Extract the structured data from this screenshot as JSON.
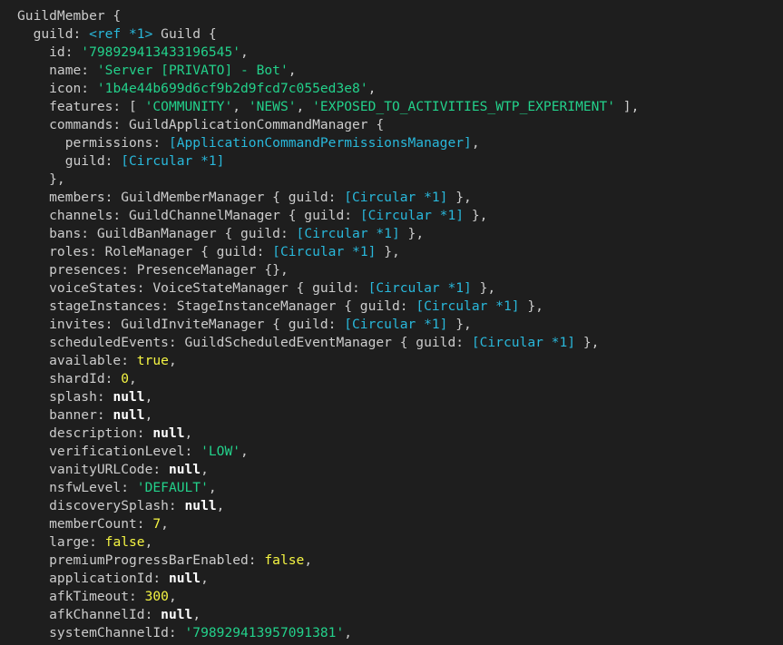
{
  "colors": {
    "background": "#1e1e1e",
    "text": "#cccccc",
    "string": "#23d18b",
    "number": "#f5f543",
    "boolean": "#f5f543",
    "null": "#ffffff",
    "reference": "#29b8db"
  },
  "lines": [
    [
      [
        "plain",
        "GuildMember {"
      ]
    ],
    [
      [
        "plain",
        "  guild: "
      ],
      [
        "ref",
        "<ref *1>"
      ],
      [
        "plain",
        " Guild {"
      ]
    ],
    [
      [
        "plain",
        "    id: "
      ],
      [
        "str",
        "'798929413433196545'"
      ],
      [
        "plain",
        ","
      ]
    ],
    [
      [
        "plain",
        "    name: "
      ],
      [
        "str",
        "'Server [PRIVATO] - Bot'"
      ],
      [
        "plain",
        ","
      ]
    ],
    [
      [
        "plain",
        "    icon: "
      ],
      [
        "str",
        "'1b4e44b699d6cf9b2d9fcd7c055ed3e8'"
      ],
      [
        "plain",
        ","
      ]
    ],
    [
      [
        "plain",
        "    features: [ "
      ],
      [
        "str",
        "'COMMUNITY'"
      ],
      [
        "plain",
        ", "
      ],
      [
        "str",
        "'NEWS'"
      ],
      [
        "plain",
        ", "
      ],
      [
        "str",
        "'EXPOSED_TO_ACTIVITIES_WTP_EXPERIMENT'"
      ],
      [
        "plain",
        " ],"
      ]
    ],
    [
      [
        "plain",
        "    commands: GuildApplicationCommandManager {"
      ]
    ],
    [
      [
        "plain",
        "      permissions: "
      ],
      [
        "ref",
        "[ApplicationCommandPermissionsManager]"
      ],
      [
        "plain",
        ","
      ]
    ],
    [
      [
        "plain",
        "      guild: "
      ],
      [
        "ref",
        "[Circular *1]"
      ]
    ],
    [
      [
        "plain",
        "    },"
      ]
    ],
    [
      [
        "plain",
        "    members: GuildMemberManager { guild: "
      ],
      [
        "ref",
        "[Circular *1]"
      ],
      [
        "plain",
        " },"
      ]
    ],
    [
      [
        "plain",
        "    channels: GuildChannelManager { guild: "
      ],
      [
        "ref",
        "[Circular *1]"
      ],
      [
        "plain",
        " },"
      ]
    ],
    [
      [
        "plain",
        "    bans: GuildBanManager { guild: "
      ],
      [
        "ref",
        "[Circular *1]"
      ],
      [
        "plain",
        " },"
      ]
    ],
    [
      [
        "plain",
        "    roles: RoleManager { guild: "
      ],
      [
        "ref",
        "[Circular *1]"
      ],
      [
        "plain",
        " },"
      ]
    ],
    [
      [
        "plain",
        "    presences: PresenceManager {},"
      ]
    ],
    [
      [
        "plain",
        "    voiceStates: VoiceStateManager { guild: "
      ],
      [
        "ref",
        "[Circular *1]"
      ],
      [
        "plain",
        " },"
      ]
    ],
    [
      [
        "plain",
        "    stageInstances: StageInstanceManager { guild: "
      ],
      [
        "ref",
        "[Circular *1]"
      ],
      [
        "plain",
        " },"
      ]
    ],
    [
      [
        "plain",
        "    invites: GuildInviteManager { guild: "
      ],
      [
        "ref",
        "[Circular *1]"
      ],
      [
        "plain",
        " },"
      ]
    ],
    [
      [
        "plain",
        "    scheduledEvents: GuildScheduledEventManager { guild: "
      ],
      [
        "ref",
        "[Circular *1]"
      ],
      [
        "plain",
        " },"
      ]
    ],
    [
      [
        "plain",
        "    available: "
      ],
      [
        "bool",
        "true"
      ],
      [
        "plain",
        ","
      ]
    ],
    [
      [
        "plain",
        "    shardId: "
      ],
      [
        "num",
        "0"
      ],
      [
        "plain",
        ","
      ]
    ],
    [
      [
        "plain",
        "    splash: "
      ],
      [
        "null",
        "null"
      ],
      [
        "plain",
        ","
      ]
    ],
    [
      [
        "plain",
        "    banner: "
      ],
      [
        "null",
        "null"
      ],
      [
        "plain",
        ","
      ]
    ],
    [
      [
        "plain",
        "    description: "
      ],
      [
        "null",
        "null"
      ],
      [
        "plain",
        ","
      ]
    ],
    [
      [
        "plain",
        "    verificationLevel: "
      ],
      [
        "str",
        "'LOW'"
      ],
      [
        "plain",
        ","
      ]
    ],
    [
      [
        "plain",
        "    vanityURLCode: "
      ],
      [
        "null",
        "null"
      ],
      [
        "plain",
        ","
      ]
    ],
    [
      [
        "plain",
        "    nsfwLevel: "
      ],
      [
        "str",
        "'DEFAULT'"
      ],
      [
        "plain",
        ","
      ]
    ],
    [
      [
        "plain",
        "    discoverySplash: "
      ],
      [
        "null",
        "null"
      ],
      [
        "plain",
        ","
      ]
    ],
    [
      [
        "plain",
        "    memberCount: "
      ],
      [
        "num",
        "7"
      ],
      [
        "plain",
        ","
      ]
    ],
    [
      [
        "plain",
        "    large: "
      ],
      [
        "bool",
        "false"
      ],
      [
        "plain",
        ","
      ]
    ],
    [
      [
        "plain",
        "    premiumProgressBarEnabled: "
      ],
      [
        "bool",
        "false"
      ],
      [
        "plain",
        ","
      ]
    ],
    [
      [
        "plain",
        "    applicationId: "
      ],
      [
        "null",
        "null"
      ],
      [
        "plain",
        ","
      ]
    ],
    [
      [
        "plain",
        "    afkTimeout: "
      ],
      [
        "num",
        "300"
      ],
      [
        "plain",
        ","
      ]
    ],
    [
      [
        "plain",
        "    afkChannelId: "
      ],
      [
        "null",
        "null"
      ],
      [
        "plain",
        ","
      ]
    ],
    [
      [
        "plain",
        "    systemChannelId: "
      ],
      [
        "str",
        "'798929413957091381'"
      ],
      [
        "plain",
        ","
      ]
    ]
  ]
}
